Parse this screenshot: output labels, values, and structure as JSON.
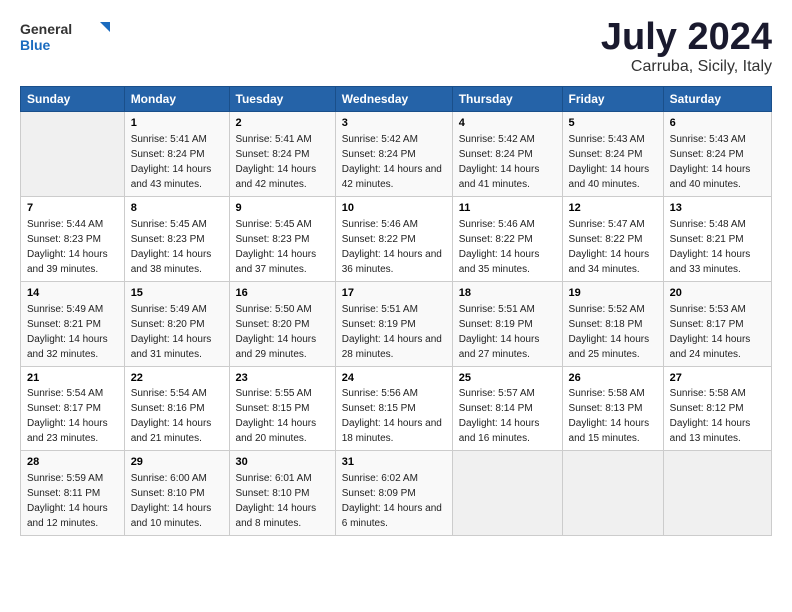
{
  "header": {
    "logo_general": "General",
    "logo_blue": "Blue",
    "month_title": "July 2024",
    "location": "Carruba, Sicily, Italy"
  },
  "days_of_week": [
    "Sunday",
    "Monday",
    "Tuesday",
    "Wednesday",
    "Thursday",
    "Friday",
    "Saturday"
  ],
  "weeks": [
    [
      {
        "day": "",
        "sunrise": "",
        "sunset": "",
        "daylight": ""
      },
      {
        "day": "1",
        "sunrise": "Sunrise: 5:41 AM",
        "sunset": "Sunset: 8:24 PM",
        "daylight": "Daylight: 14 hours and 43 minutes."
      },
      {
        "day": "2",
        "sunrise": "Sunrise: 5:41 AM",
        "sunset": "Sunset: 8:24 PM",
        "daylight": "Daylight: 14 hours and 42 minutes."
      },
      {
        "day": "3",
        "sunrise": "Sunrise: 5:42 AM",
        "sunset": "Sunset: 8:24 PM",
        "daylight": "Daylight: 14 hours and 42 minutes."
      },
      {
        "day": "4",
        "sunrise": "Sunrise: 5:42 AM",
        "sunset": "Sunset: 8:24 PM",
        "daylight": "Daylight: 14 hours and 41 minutes."
      },
      {
        "day": "5",
        "sunrise": "Sunrise: 5:43 AM",
        "sunset": "Sunset: 8:24 PM",
        "daylight": "Daylight: 14 hours and 40 minutes."
      },
      {
        "day": "6",
        "sunrise": "Sunrise: 5:43 AM",
        "sunset": "Sunset: 8:24 PM",
        "daylight": "Daylight: 14 hours and 40 minutes."
      }
    ],
    [
      {
        "day": "7",
        "sunrise": "Sunrise: 5:44 AM",
        "sunset": "Sunset: 8:23 PM",
        "daylight": "Daylight: 14 hours and 39 minutes."
      },
      {
        "day": "8",
        "sunrise": "Sunrise: 5:45 AM",
        "sunset": "Sunset: 8:23 PM",
        "daylight": "Daylight: 14 hours and 38 minutes."
      },
      {
        "day": "9",
        "sunrise": "Sunrise: 5:45 AM",
        "sunset": "Sunset: 8:23 PM",
        "daylight": "Daylight: 14 hours and 37 minutes."
      },
      {
        "day": "10",
        "sunrise": "Sunrise: 5:46 AM",
        "sunset": "Sunset: 8:22 PM",
        "daylight": "Daylight: 14 hours and 36 minutes."
      },
      {
        "day": "11",
        "sunrise": "Sunrise: 5:46 AM",
        "sunset": "Sunset: 8:22 PM",
        "daylight": "Daylight: 14 hours and 35 minutes."
      },
      {
        "day": "12",
        "sunrise": "Sunrise: 5:47 AM",
        "sunset": "Sunset: 8:22 PM",
        "daylight": "Daylight: 14 hours and 34 minutes."
      },
      {
        "day": "13",
        "sunrise": "Sunrise: 5:48 AM",
        "sunset": "Sunset: 8:21 PM",
        "daylight": "Daylight: 14 hours and 33 minutes."
      }
    ],
    [
      {
        "day": "14",
        "sunrise": "Sunrise: 5:49 AM",
        "sunset": "Sunset: 8:21 PM",
        "daylight": "Daylight: 14 hours and 32 minutes."
      },
      {
        "day": "15",
        "sunrise": "Sunrise: 5:49 AM",
        "sunset": "Sunset: 8:20 PM",
        "daylight": "Daylight: 14 hours and 31 minutes."
      },
      {
        "day": "16",
        "sunrise": "Sunrise: 5:50 AM",
        "sunset": "Sunset: 8:20 PM",
        "daylight": "Daylight: 14 hours and 29 minutes."
      },
      {
        "day": "17",
        "sunrise": "Sunrise: 5:51 AM",
        "sunset": "Sunset: 8:19 PM",
        "daylight": "Daylight: 14 hours and 28 minutes."
      },
      {
        "day": "18",
        "sunrise": "Sunrise: 5:51 AM",
        "sunset": "Sunset: 8:19 PM",
        "daylight": "Daylight: 14 hours and 27 minutes."
      },
      {
        "day": "19",
        "sunrise": "Sunrise: 5:52 AM",
        "sunset": "Sunset: 8:18 PM",
        "daylight": "Daylight: 14 hours and 25 minutes."
      },
      {
        "day": "20",
        "sunrise": "Sunrise: 5:53 AM",
        "sunset": "Sunset: 8:17 PM",
        "daylight": "Daylight: 14 hours and 24 minutes."
      }
    ],
    [
      {
        "day": "21",
        "sunrise": "Sunrise: 5:54 AM",
        "sunset": "Sunset: 8:17 PM",
        "daylight": "Daylight: 14 hours and 23 minutes."
      },
      {
        "day": "22",
        "sunrise": "Sunrise: 5:54 AM",
        "sunset": "Sunset: 8:16 PM",
        "daylight": "Daylight: 14 hours and 21 minutes."
      },
      {
        "day": "23",
        "sunrise": "Sunrise: 5:55 AM",
        "sunset": "Sunset: 8:15 PM",
        "daylight": "Daylight: 14 hours and 20 minutes."
      },
      {
        "day": "24",
        "sunrise": "Sunrise: 5:56 AM",
        "sunset": "Sunset: 8:15 PM",
        "daylight": "Daylight: 14 hours and 18 minutes."
      },
      {
        "day": "25",
        "sunrise": "Sunrise: 5:57 AM",
        "sunset": "Sunset: 8:14 PM",
        "daylight": "Daylight: 14 hours and 16 minutes."
      },
      {
        "day": "26",
        "sunrise": "Sunrise: 5:58 AM",
        "sunset": "Sunset: 8:13 PM",
        "daylight": "Daylight: 14 hours and 15 minutes."
      },
      {
        "day": "27",
        "sunrise": "Sunrise: 5:58 AM",
        "sunset": "Sunset: 8:12 PM",
        "daylight": "Daylight: 14 hours and 13 minutes."
      }
    ],
    [
      {
        "day": "28",
        "sunrise": "Sunrise: 5:59 AM",
        "sunset": "Sunset: 8:11 PM",
        "daylight": "Daylight: 14 hours and 12 minutes."
      },
      {
        "day": "29",
        "sunrise": "Sunrise: 6:00 AM",
        "sunset": "Sunset: 8:10 PM",
        "daylight": "Daylight: 14 hours and 10 minutes."
      },
      {
        "day": "30",
        "sunrise": "Sunrise: 6:01 AM",
        "sunset": "Sunset: 8:10 PM",
        "daylight": "Daylight: 14 hours and 8 minutes."
      },
      {
        "day": "31",
        "sunrise": "Sunrise: 6:02 AM",
        "sunset": "Sunset: 8:09 PM",
        "daylight": "Daylight: 14 hours and 6 minutes."
      },
      {
        "day": "",
        "sunrise": "",
        "sunset": "",
        "daylight": ""
      },
      {
        "day": "",
        "sunrise": "",
        "sunset": "",
        "daylight": ""
      },
      {
        "day": "",
        "sunrise": "",
        "sunset": "",
        "daylight": ""
      }
    ]
  ]
}
